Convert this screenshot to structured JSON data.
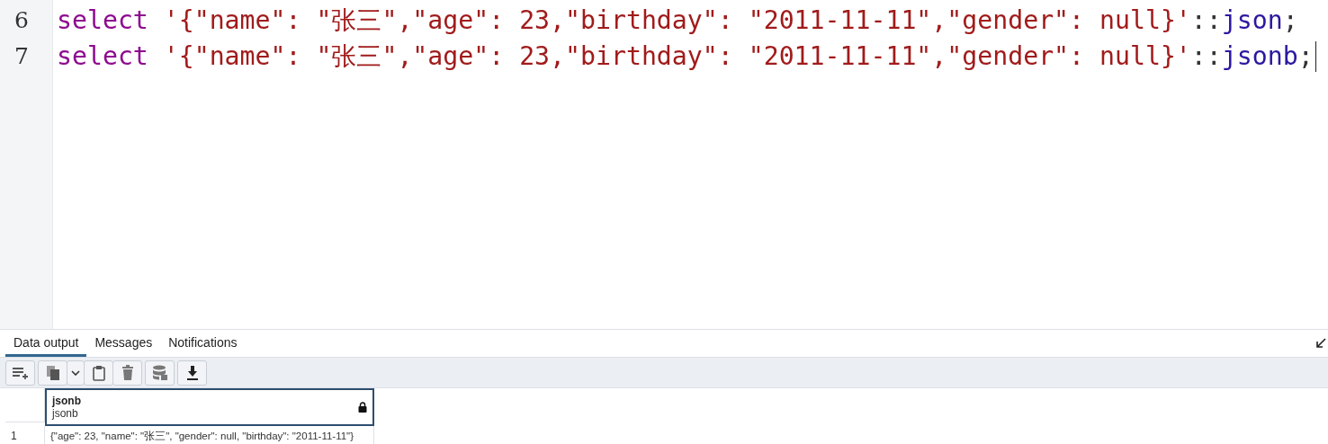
{
  "editor": {
    "lines": [
      {
        "number": "6",
        "tokens": [
          {
            "kind": "keyword",
            "text": "select"
          },
          {
            "kind": "string",
            "text": "'{\"name\": \"张三\",\"age\": 23,\"birthday\": \"2011-11-11\",\"gender\": null}'"
          },
          {
            "kind": "operator",
            "text": "::"
          },
          {
            "kind": "type",
            "text": "json"
          },
          {
            "kind": "operator",
            "text": ";"
          }
        ],
        "cursor": false
      },
      {
        "number": "7",
        "tokens": [
          {
            "kind": "keyword",
            "text": "select"
          },
          {
            "kind": "string",
            "text": "'{\"name\": \"张三\",\"age\": 23,\"birthday\": \"2011-11-11\",\"gender\": null}'"
          },
          {
            "kind": "operator",
            "text": "::"
          },
          {
            "kind": "type",
            "text": "jsonb"
          },
          {
            "kind": "operator",
            "text": ";"
          }
        ],
        "cursor": true
      }
    ]
  },
  "results": {
    "tabs": [
      {
        "label": "Data output",
        "selected": true
      },
      {
        "label": "Messages",
        "selected": false
      },
      {
        "label": "Notifications",
        "selected": false
      }
    ],
    "toolbar": [
      {
        "kind": "add-row"
      },
      {
        "kind": "copy"
      },
      {
        "kind": "caret"
      },
      {
        "kind": "paste"
      },
      {
        "kind": "delete"
      },
      {
        "kind": "save-data"
      },
      {
        "kind": "download"
      }
    ],
    "grid": {
      "columns": [
        {
          "name": "jsonb",
          "type": "jsonb",
          "locked": true
        }
      ],
      "rows": [
        {
          "number": "1",
          "cells": [
            "{\"age\": 23, \"name\": \"张三\", \"gender\": null, \"birthday\": \"2011-11-11\"}"
          ]
        }
      ]
    }
  }
}
